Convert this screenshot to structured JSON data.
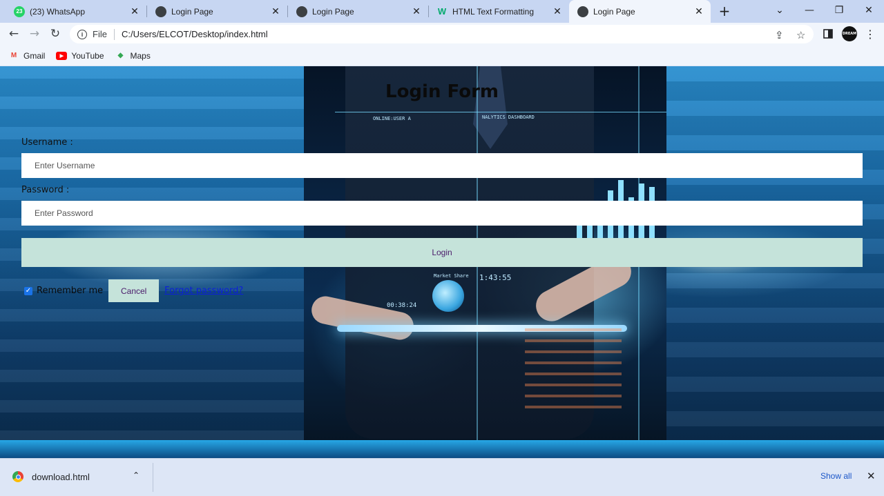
{
  "browser": {
    "tabs": [
      {
        "title": "(23) WhatsApp",
        "icon": "whatsapp-icon",
        "badge": "23"
      },
      {
        "title": "Login Page",
        "icon": "globe-icon"
      },
      {
        "title": "Login Page",
        "icon": "globe-icon"
      },
      {
        "title": "HTML Text Formatting",
        "icon": "w3schools-icon"
      },
      {
        "title": "Login Page",
        "icon": "globe-icon",
        "active": true
      }
    ],
    "omnibox": {
      "scheme_label": "File",
      "url": "C:/Users/ELCOT/Desktop/index.html"
    },
    "bookmarks": [
      {
        "label": "Gmail",
        "icon": "gmail-icon"
      },
      {
        "label": "YouTube",
        "icon": "youtube-icon"
      },
      {
        "label": "Maps",
        "icon": "maps-icon"
      }
    ],
    "profile_text": "DREAM"
  },
  "page": {
    "title": "Login Form",
    "username_label": "Username :",
    "username_placeholder": "Enter Username",
    "password_label": "Password :",
    "password_placeholder": "Enter Password",
    "login_button": "Login",
    "remember_label": "Remember me",
    "remember_checked": true,
    "cancel_button": "Cancel",
    "forgot_link": "Forgot password?"
  },
  "downloads": {
    "file_name": "download.html",
    "show_all": "Show all"
  },
  "colors": {
    "button_bg": "#c5e3da",
    "button_text": "#4a1a6a",
    "link": "#0b1fd8",
    "chrome_frame": "#c7d6f2"
  }
}
